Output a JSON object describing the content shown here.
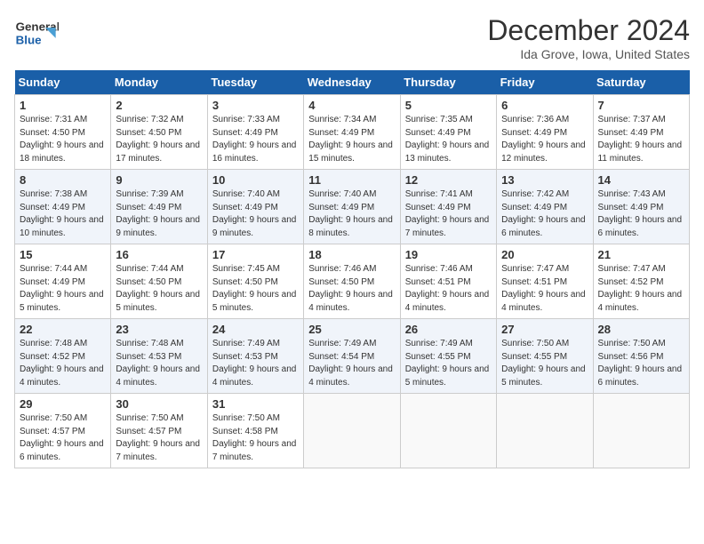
{
  "header": {
    "logo_line1": "General",
    "logo_line2": "Blue",
    "month_title": "December 2024",
    "location": "Ida Grove, Iowa, United States"
  },
  "days_of_week": [
    "Sunday",
    "Monday",
    "Tuesday",
    "Wednesday",
    "Thursday",
    "Friday",
    "Saturday"
  ],
  "weeks": [
    [
      {
        "day": 1,
        "sunrise": "7:31 AM",
        "sunset": "4:50 PM",
        "daylight": "9 hours and 18 minutes."
      },
      {
        "day": 2,
        "sunrise": "7:32 AM",
        "sunset": "4:50 PM",
        "daylight": "9 hours and 17 minutes."
      },
      {
        "day": 3,
        "sunrise": "7:33 AM",
        "sunset": "4:49 PM",
        "daylight": "9 hours and 16 minutes."
      },
      {
        "day": 4,
        "sunrise": "7:34 AM",
        "sunset": "4:49 PM",
        "daylight": "9 hours and 15 minutes."
      },
      {
        "day": 5,
        "sunrise": "7:35 AM",
        "sunset": "4:49 PM",
        "daylight": "9 hours and 13 minutes."
      },
      {
        "day": 6,
        "sunrise": "7:36 AM",
        "sunset": "4:49 PM",
        "daylight": "9 hours and 12 minutes."
      },
      {
        "day": 7,
        "sunrise": "7:37 AM",
        "sunset": "4:49 PM",
        "daylight": "9 hours and 11 minutes."
      }
    ],
    [
      {
        "day": 8,
        "sunrise": "7:38 AM",
        "sunset": "4:49 PM",
        "daylight": "9 hours and 10 minutes."
      },
      {
        "day": 9,
        "sunrise": "7:39 AM",
        "sunset": "4:49 PM",
        "daylight": "9 hours and 9 minutes."
      },
      {
        "day": 10,
        "sunrise": "7:40 AM",
        "sunset": "4:49 PM",
        "daylight": "9 hours and 9 minutes."
      },
      {
        "day": 11,
        "sunrise": "7:40 AM",
        "sunset": "4:49 PM",
        "daylight": "9 hours and 8 minutes."
      },
      {
        "day": 12,
        "sunrise": "7:41 AM",
        "sunset": "4:49 PM",
        "daylight": "9 hours and 7 minutes."
      },
      {
        "day": 13,
        "sunrise": "7:42 AM",
        "sunset": "4:49 PM",
        "daylight": "9 hours and 6 minutes."
      },
      {
        "day": 14,
        "sunrise": "7:43 AM",
        "sunset": "4:49 PM",
        "daylight": "9 hours and 6 minutes."
      }
    ],
    [
      {
        "day": 15,
        "sunrise": "7:44 AM",
        "sunset": "4:49 PM",
        "daylight": "9 hours and 5 minutes."
      },
      {
        "day": 16,
        "sunrise": "7:44 AM",
        "sunset": "4:50 PM",
        "daylight": "9 hours and 5 minutes."
      },
      {
        "day": 17,
        "sunrise": "7:45 AM",
        "sunset": "4:50 PM",
        "daylight": "9 hours and 5 minutes."
      },
      {
        "day": 18,
        "sunrise": "7:46 AM",
        "sunset": "4:50 PM",
        "daylight": "9 hours and 4 minutes."
      },
      {
        "day": 19,
        "sunrise": "7:46 AM",
        "sunset": "4:51 PM",
        "daylight": "9 hours and 4 minutes."
      },
      {
        "day": 20,
        "sunrise": "7:47 AM",
        "sunset": "4:51 PM",
        "daylight": "9 hours and 4 minutes."
      },
      {
        "day": 21,
        "sunrise": "7:47 AM",
        "sunset": "4:52 PM",
        "daylight": "9 hours and 4 minutes."
      }
    ],
    [
      {
        "day": 22,
        "sunrise": "7:48 AM",
        "sunset": "4:52 PM",
        "daylight": "9 hours and 4 minutes."
      },
      {
        "day": 23,
        "sunrise": "7:48 AM",
        "sunset": "4:53 PM",
        "daylight": "9 hours and 4 minutes."
      },
      {
        "day": 24,
        "sunrise": "7:49 AM",
        "sunset": "4:53 PM",
        "daylight": "9 hours and 4 minutes."
      },
      {
        "day": 25,
        "sunrise": "7:49 AM",
        "sunset": "4:54 PM",
        "daylight": "9 hours and 4 minutes."
      },
      {
        "day": 26,
        "sunrise": "7:49 AM",
        "sunset": "4:55 PM",
        "daylight": "9 hours and 5 minutes."
      },
      {
        "day": 27,
        "sunrise": "7:50 AM",
        "sunset": "4:55 PM",
        "daylight": "9 hours and 5 minutes."
      },
      {
        "day": 28,
        "sunrise": "7:50 AM",
        "sunset": "4:56 PM",
        "daylight": "9 hours and 6 minutes."
      }
    ],
    [
      {
        "day": 29,
        "sunrise": "7:50 AM",
        "sunset": "4:57 PM",
        "daylight": "9 hours and 6 minutes."
      },
      {
        "day": 30,
        "sunrise": "7:50 AM",
        "sunset": "4:57 PM",
        "daylight": "9 hours and 7 minutes."
      },
      {
        "day": 31,
        "sunrise": "7:50 AM",
        "sunset": "4:58 PM",
        "daylight": "9 hours and 7 minutes."
      },
      null,
      null,
      null,
      null
    ]
  ]
}
